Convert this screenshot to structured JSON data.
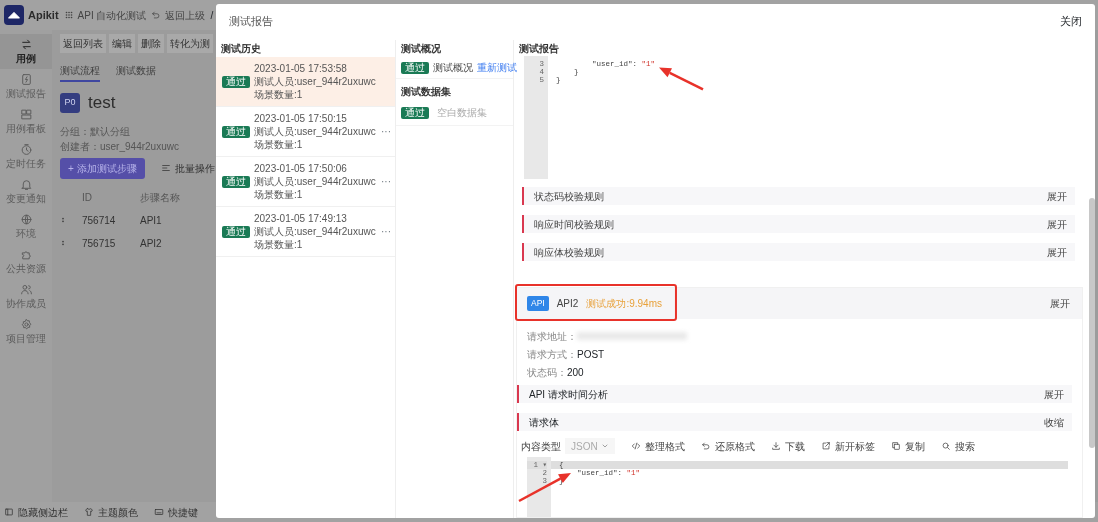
{
  "app": {
    "logo": "Apikit",
    "project": "API 自动化测试",
    "back": "返回上级",
    "separator": "/",
    "nav": [
      {
        "label": "用例",
        "kind": "swap",
        "selected": true
      },
      {
        "label": "测试报告",
        "kind": "report",
        "selected": false
      },
      {
        "label": "用例看板",
        "kind": "board",
        "selected": false
      },
      {
        "label": "定时任务",
        "kind": "clock",
        "selected": false
      },
      {
        "label": "变更通知",
        "kind": "bell",
        "selected": false
      },
      {
        "label": "环境",
        "kind": "globe",
        "selected": false
      },
      {
        "label": "公共资源",
        "kind": "puzzle",
        "selected": false
      },
      {
        "label": "协作成员",
        "kind": "people",
        "selected": false
      },
      {
        "label": "项目管理",
        "kind": "gear",
        "selected": false
      }
    ],
    "toolbar": [
      "返回列表",
      "编辑",
      "删除",
      "转化为测"
    ],
    "tabs": [
      {
        "label": "测试流程",
        "selected": true
      },
      {
        "label": "测试数据",
        "selected": false
      }
    ],
    "case": {
      "priority": "P0",
      "title": "test",
      "group": "分组：默认分组",
      "creator": "创建者：user_944r2uxuwc"
    },
    "add_button": "+ 添加测试步骤",
    "batch": "批量操作",
    "table": {
      "columns": [
        "ID",
        "步骤名称"
      ],
      "rows": [
        {
          "id": "756714",
          "name": "API1"
        },
        {
          "id": "756715",
          "name": "API2"
        }
      ]
    },
    "footer": [
      {
        "label": "隐藏侧边栏",
        "kind": "sidebar"
      },
      {
        "label": "主题颜色",
        "kind": "shirt"
      },
      {
        "label": "快捷键",
        "kind": "keyboard"
      }
    ]
  },
  "modal": {
    "title": "测试报告",
    "close": "关闭",
    "history": {
      "title": "测试历史",
      "items": [
        {
          "status": "通过",
          "time": "2023-01-05 17:53:58",
          "tester": "测试人员:user_944r2uxuwc",
          "count": "场景数量:1",
          "selected": true
        },
        {
          "status": "通过",
          "time": "2023-01-05 17:50:15",
          "tester": "测试人员:user_944r2uxuwc",
          "count": "场景数量:1",
          "selected": false,
          "menu": "···"
        },
        {
          "status": "通过",
          "time": "2023-01-05 17:50:06",
          "tester": "测试人员:user_944r2uxuwc",
          "count": "场景数量:1",
          "selected": false,
          "menu": "···"
        },
        {
          "status": "通过",
          "time": "2023-01-05 17:49:13",
          "tester": "测试人员:user_944r2uxuwc",
          "count": "场景数量:1",
          "selected": false,
          "menu": "···"
        }
      ]
    },
    "overview": {
      "title": "测试概况",
      "item": {
        "status": "通过",
        "label": "测试概况",
        "action": "重新测试"
      },
      "datasets_title": "测试数据集",
      "datasets": [
        {
          "status": "通过",
          "label": "空白数据集"
        }
      ]
    },
    "report": {
      "title": "测试报告",
      "top_code": [
        {
          "no": "3",
          "code": "        \"user_id\": ",
          "value": "\"1\""
        },
        {
          "no": "4",
          "code": "    }"
        },
        {
          "no": "5",
          "code": "}"
        }
      ],
      "rules": [
        {
          "label": "状态码校验规则",
          "action": "展开"
        },
        {
          "label": "响应时间校验规则",
          "action": "展开"
        },
        {
          "label": "响应体校验规则",
          "action": "展开"
        }
      ],
      "api": {
        "badge": "API",
        "name": "API2",
        "result": "测试成功:9.94ms",
        "action": "展开",
        "fields": [
          {
            "label": "请求地址：",
            "kind": "redacted"
          },
          {
            "label": "请求方式：",
            "value": "POST",
            "kind": "text"
          },
          {
            "label": "状态码：",
            "value": "200",
            "kind": "text"
          }
        ],
        "sections": [
          {
            "label": "API 请求时间分析",
            "action": "展开"
          },
          {
            "label": "请求体",
            "action": "收缩"
          }
        ],
        "content_type_label": "内容类型",
        "content_type": "JSON",
        "tools": [
          {
            "kind": "code",
            "label": "整理格式"
          },
          {
            "kind": "undo",
            "label": "还原格式"
          },
          {
            "kind": "download",
            "label": "下载"
          },
          {
            "kind": "external",
            "label": "新开标签"
          },
          {
            "kind": "copy",
            "label": "复制"
          },
          {
            "kind": "search",
            "label": "搜索"
          }
        ],
        "code": [
          {
            "no": "1",
            "code": "{",
            "fold": "▾",
            "active": true
          },
          {
            "no": "2",
            "code": "    \"user_id\": ",
            "value": "\"1\"",
            "active": false
          },
          {
            "no": "3",
            "code": "}",
            "active": false
          }
        ]
      }
    }
  }
}
